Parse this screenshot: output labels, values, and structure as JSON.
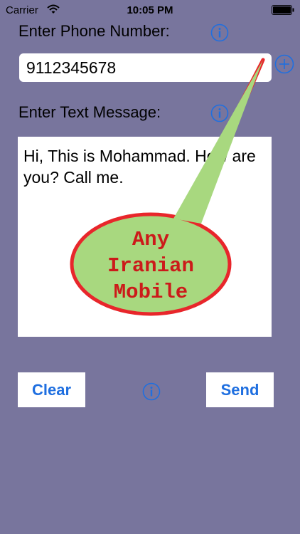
{
  "status_bar": {
    "carrier": "Carrier",
    "time": "10:05 PM",
    "wifi_icon": "wifi-icon",
    "battery_icon": "battery-icon"
  },
  "phone": {
    "label": "Enter Phone Number:",
    "value": "9112345678",
    "info_icon": "info-icon",
    "add_icon": "add-contact-icon"
  },
  "message": {
    "label": "Enter Text Message:",
    "value": "Hi, This is Mohammad. How are you?  Call me.",
    "info_icon": "info-icon"
  },
  "callout": {
    "lines": [
      "Any",
      "Iranian",
      "Mobile"
    ],
    "fill_color": "#a8d87f",
    "border_color": "#e8262b",
    "text_color": "#cc1a1a"
  },
  "buttons": {
    "clear": "Clear",
    "send": "Send",
    "info_icon": "info-icon"
  },
  "colors": {
    "background": "#78759d",
    "accent": "#1f6fe0"
  }
}
